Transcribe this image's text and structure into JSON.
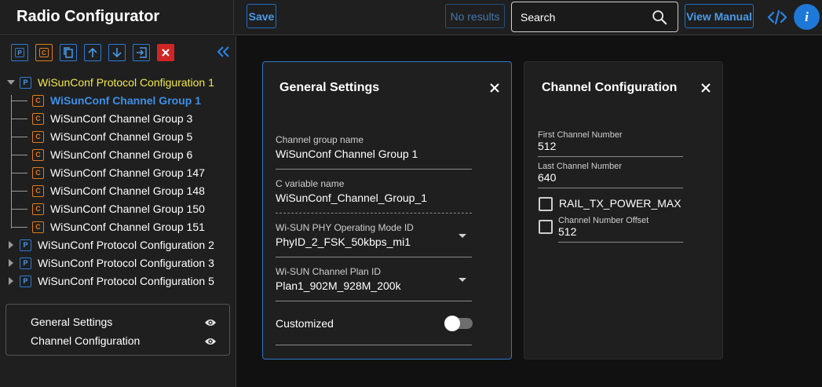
{
  "header": {
    "title": "Radio Configurator",
    "save_label": "Save",
    "no_results_label": "No results",
    "search_placeholder": "Search",
    "view_manual_label": "View Manual",
    "info_glyph": "i",
    "icons": {
      "search": "search-icon",
      "code": "code-icon",
      "info": "info-icon"
    },
    "accent_color": "#1e78d8"
  },
  "sidebar": {
    "toolbar": [
      {
        "icon": "protocol-p-icon",
        "glyph": "P"
      },
      {
        "icon": "channel-c-icon",
        "glyph": "C"
      },
      {
        "icon": "copy-icon"
      },
      {
        "icon": "arrow-up-icon"
      },
      {
        "icon": "arrow-down-icon"
      },
      {
        "icon": "import-icon"
      },
      {
        "icon": "delete-x-icon"
      }
    ],
    "collapse_icon": "double-chevron-left-icon",
    "badge_p": "P",
    "badge_c": "C",
    "tree": [
      {
        "label": "WiSunConf Protocol Configuration 1",
        "type": "P",
        "expanded": true,
        "highlight_color": "#f2e84b"
      },
      {
        "label": "WiSunConf Channel Group 1",
        "type": "C",
        "selected": true,
        "selected_color": "#3d8fe6"
      },
      {
        "label": "WiSunConf Channel Group 3",
        "type": "C"
      },
      {
        "label": "WiSunConf Channel Group 5",
        "type": "C"
      },
      {
        "label": "WiSunConf Channel Group 6",
        "type": "C"
      },
      {
        "label": "WiSunConf Channel Group 147",
        "type": "C"
      },
      {
        "label": "WiSunConf Channel Group 148",
        "type": "C"
      },
      {
        "label": "WiSunConf Channel Group 150",
        "type": "C"
      },
      {
        "label": "WiSunConf Channel Group 151",
        "type": "C"
      },
      {
        "label": "WiSunConf Protocol Configuration 2",
        "type": "P",
        "expanded": false
      },
      {
        "label": "WiSunConf Protocol Configuration 3",
        "type": "P",
        "expanded": false
      },
      {
        "label": "WiSunConf Protocol Configuration 5",
        "type": "P",
        "expanded": false
      }
    ],
    "legend": [
      {
        "label": "General Settings",
        "icon": "eye-icon"
      },
      {
        "label": "Channel Configuration",
        "icon": "eye-icon"
      }
    ]
  },
  "general": {
    "title": "General Settings",
    "close_icon": "close-icon",
    "channel_group_name_label": "Channel group name",
    "channel_group_name_value": "WiSunConf Channel Group 1",
    "c_variable_name_label": "C variable name",
    "c_variable_name_value": "WiSunConf_Channel_Group_1",
    "phy_mode_label": "Wi-SUN PHY Operating Mode ID",
    "phy_mode_value": "PhyID_2_FSK_50kbps_mi1",
    "channel_plan_label": "Wi-SUN Channel Plan ID",
    "channel_plan_value": "Plan1_902M_928M_200k",
    "customized_label": "Customized",
    "customized_on": false
  },
  "channel": {
    "title": "Channel Configuration",
    "close_icon": "close-icon",
    "first_channel_label": "First Channel Number",
    "first_channel_value": "512",
    "last_channel_label": "Last Channel Number",
    "last_channel_value": "640",
    "rail_tx_label": "RAIL_TX_POWER_MAX",
    "rail_tx_checked": false,
    "offset_label": "Channel Number Offset",
    "offset_value": "512",
    "offset_checked": false
  }
}
